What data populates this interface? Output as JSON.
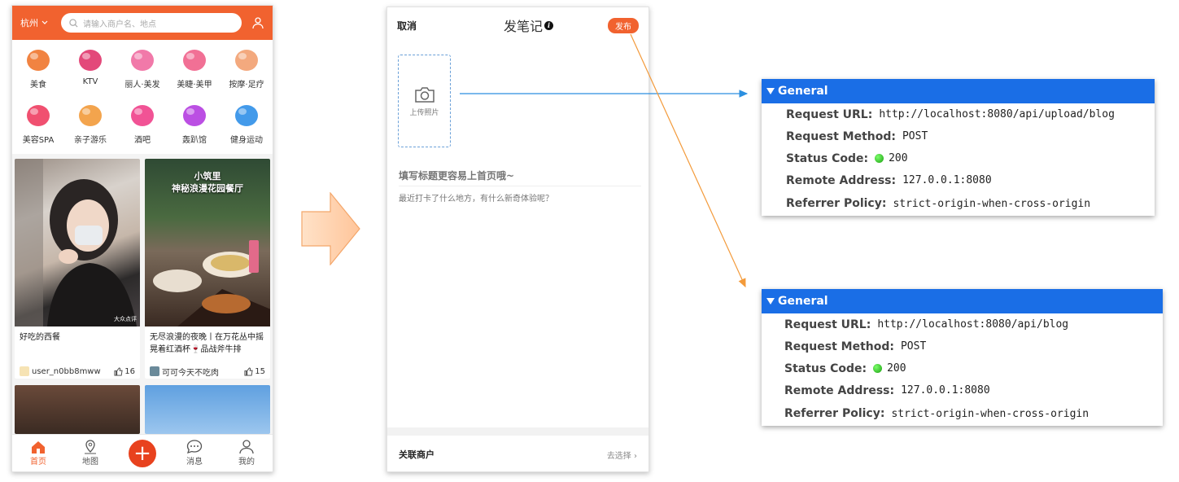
{
  "phone1": {
    "city": "杭州",
    "search_placeholder": "请输入商户名、地点",
    "categories": [
      {
        "label": "美食",
        "icon": "roast-chicken-icon",
        "color": "#f0762c"
      },
      {
        "label": "KTV",
        "icon": "microphone-icon",
        "color": "#e0356b"
      },
      {
        "label": "丽人·美发",
        "icon": "hair-icon",
        "color": "#f06aa0"
      },
      {
        "label": "美睫·美甲",
        "icon": "nail-icon",
        "color": "#f0608a"
      },
      {
        "label": "按摩·足疗",
        "icon": "massage-icon",
        "color": "#f2a070"
      },
      {
        "label": "美容SPA",
        "icon": "spa-mask-icon",
        "color": "#ee3d60"
      },
      {
        "label": "亲子游乐",
        "icon": "family-icon",
        "color": "#f29a3a"
      },
      {
        "label": "酒吧",
        "icon": "cocktail-icon",
        "color": "#f0408a"
      },
      {
        "label": "轰趴馆",
        "icon": "party-mask-icon",
        "color": "#b43ce0"
      },
      {
        "label": "健身运动",
        "icon": "dumbbell-icon",
        "color": "#2f8fe8"
      }
    ],
    "cards": [
      {
        "title": "好吃的西餐",
        "user": "user_n0bb8mww",
        "likes": "16",
        "watermark": "大众点评"
      },
      {
        "title": "无尽浪漫的夜晚丨在万花丛中摇晃着红酒杯🍷品战斧牛排",
        "user": "可可今天不吃肉",
        "likes": "15",
        "overlay_line1": "小筑里",
        "overlay_line2": "神秘浪漫花园餐厅"
      }
    ],
    "tabs": [
      {
        "label": "首页",
        "icon": "home-icon",
        "active": true
      },
      {
        "label": "地图",
        "icon": "map-pin-icon"
      },
      {
        "label": "",
        "icon": "plus-icon"
      },
      {
        "label": "消息",
        "icon": "message-icon"
      },
      {
        "label": "我的",
        "icon": "profile-icon"
      }
    ],
    "accent": "#f1622f"
  },
  "phone2": {
    "cancel": "取消",
    "title": "发笔记",
    "publish": "发布",
    "upload_label": "上传照片",
    "title_placeholder": "填写标题更容易上首页哦~",
    "body_placeholder": "最近打卡了什么地方，有什么新奇体验呢？",
    "assoc_label": "关联商户",
    "assoc_action": "去选择"
  },
  "panels": [
    {
      "header": "General",
      "request_url_key": "Request URL:",
      "request_url": "http://localhost:8080/api/upload/blog",
      "method_key": "Request Method:",
      "method": "POST",
      "status_key": "Status Code:",
      "status": "200",
      "remote_key": "Remote Address:",
      "remote": "127.0.0.1:8080",
      "policy_key": "Referrer Policy:",
      "policy": "strict-origin-when-cross-origin"
    },
    {
      "header": "General",
      "request_url_key": "Request URL:",
      "request_url": "http://localhost:8080/api/blog",
      "method_key": "Request Method:",
      "method": "POST",
      "status_key": "Status Code:",
      "status": "200",
      "remote_key": "Remote Address:",
      "remote": "127.0.0.1:8080",
      "policy_key": "Referrer Policy:",
      "policy": "strict-origin-when-cross-origin"
    }
  ],
  "colors": {
    "panel_header": "#1a6ee6",
    "arrow_blue": "#2b8fe0",
    "arrow_orange": "#f39a3a"
  }
}
